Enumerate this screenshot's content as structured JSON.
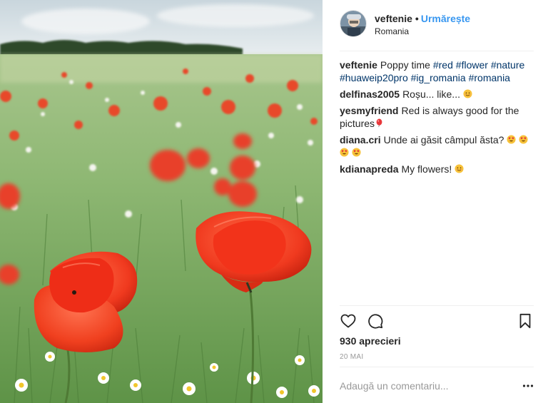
{
  "post": {
    "username": "veftenie",
    "separator": "•",
    "follow_label": "Urmărește",
    "location": "Romania",
    "caption": {
      "user": "veftenie",
      "text": "Poppy time",
      "hashtags": [
        "#red",
        "#flower",
        "#nature",
        "#huaweip20pro",
        "#ig_romania",
        "#romania"
      ]
    },
    "comments": [
      {
        "user": "delfinas2005",
        "text": "Roșu... like...",
        "emojis": [
          "smile"
        ]
      },
      {
        "user": "yesmyfriend",
        "text": "Red is always good for the pictures",
        "emojis": [
          "balloon"
        ]
      },
      {
        "user": "diana.cri",
        "text": "Unde ai găsit câmpul ăsta?",
        "emojis": [
          "heart-eyes",
          "heart-eyes",
          "heart-eyes",
          "heart-eyes"
        ]
      },
      {
        "user": "kdianapreda",
        "text": "My flowers!",
        "emojis": [
          "smile"
        ]
      }
    ],
    "actions": {
      "like_icon": "heart-outline",
      "comment_icon": "speech-bubble",
      "save_icon": "bookmark"
    },
    "likes_text": "930 aprecieri",
    "date_text": "20 MAI",
    "add_comment_placeholder": "Adaugă un comentariu...",
    "more_icon": "more-options"
  },
  "colors": {
    "link_blue": "#3897f0",
    "hashtag": "#003569",
    "muted": "#999999",
    "text": "#262626"
  }
}
